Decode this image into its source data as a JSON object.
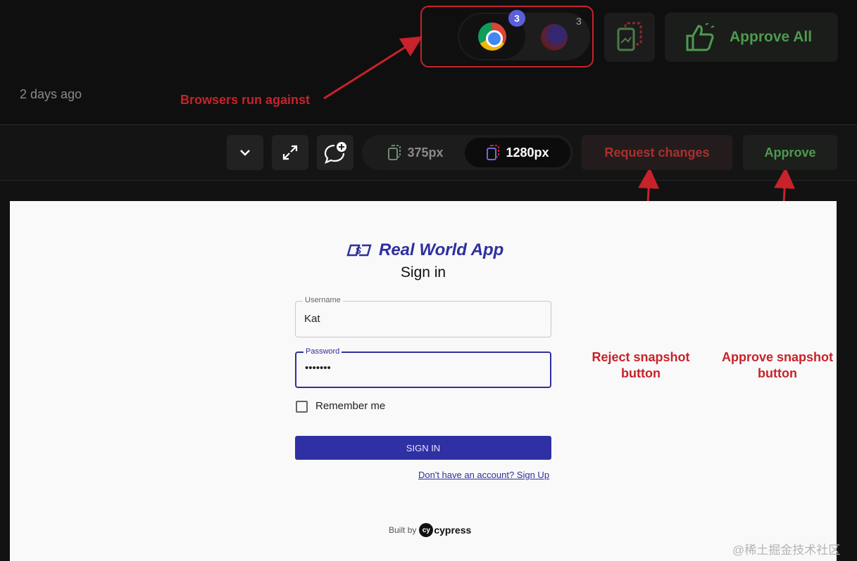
{
  "header": {
    "time_ago": "2 days ago",
    "browsers": [
      {
        "name": "chrome-icon",
        "count": "3",
        "active": true
      },
      {
        "name": "firefox-icon",
        "count": "3",
        "active": false
      }
    ],
    "approve_all_label": "Approve All"
  },
  "toolbar": {
    "viewports": [
      {
        "label": "375px",
        "active": false
      },
      {
        "label": "1280px",
        "active": true
      }
    ],
    "request_changes_label": "Request changes",
    "approve_label": "Approve"
  },
  "annotations": {
    "browsers": "Browsers run against",
    "reject_line1": "Reject snapshot",
    "reject_line2": "button",
    "approve_line1": "Approve snapshot",
    "approve_line2": "button",
    "accent_color": "#c8222a"
  },
  "snapshot": {
    "app_name": "Real World App",
    "title": "Sign in",
    "username_label": "Username",
    "username_value": "Kat",
    "password_label": "Password",
    "password_value": "•••••••",
    "remember_label": "Remember me",
    "signin_button": "SIGN IN",
    "signup_link": "Don't have an account? Sign Up",
    "built_by": "Built by",
    "built_by_brand": "cypress",
    "brand_color": "#2e2f9e"
  },
  "watermark": "@稀土掘金技术社区"
}
